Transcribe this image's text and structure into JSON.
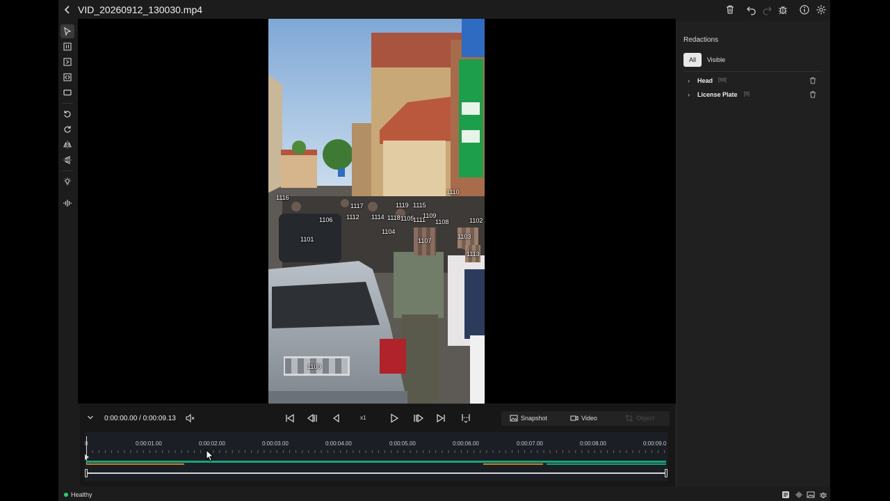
{
  "header": {
    "title": "VID_20260912_130030.mp4"
  },
  "panel": {
    "title": "Redactions",
    "filters": [
      "All",
      "Visible"
    ],
    "items": [
      {
        "name": "Head",
        "count": "[93]"
      },
      {
        "name": "License Plate",
        "count": "[5]"
      }
    ]
  },
  "controls": {
    "timecode": "0:00:00.00 / 0:00:09.13",
    "speed": "x1",
    "snapshot_label": "Snapshot",
    "video_label": "Video",
    "object_label": "Object"
  },
  "timeline": {
    "ticks": [
      "0",
      "0:00:01.00",
      "0:00:02.00",
      "0:00:03.00",
      "0:00:04.00",
      "0:00:05.00",
      "0:00:06.00",
      "0:00:07.00",
      "0:00:08.00",
      "0:00:09.0"
    ]
  },
  "detections": [
    "1116",
    "1117",
    "1119",
    "1115",
    "1110",
    "1106",
    "1112",
    "1114",
    "1118",
    "1105",
    "1111",
    "1109",
    "1108",
    "1102",
    "1104",
    "1107",
    "1103",
    "1101",
    "1113",
    "1100"
  ],
  "status": {
    "health": "Healthy"
  },
  "colors": {
    "accent_green": "#1aa57a",
    "track_orange": "#c5862a",
    "healthy": "#2ecc71"
  }
}
